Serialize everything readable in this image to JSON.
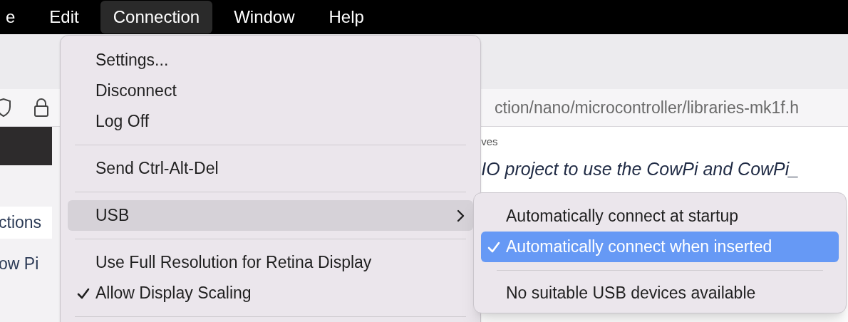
{
  "menu_bar": [
    {
      "label": "e",
      "selected": false
    },
    {
      "label": "Edit",
      "selected": false
    },
    {
      "label": "Connection",
      "selected": true
    },
    {
      "label": "Window",
      "selected": false
    },
    {
      "label": "Help",
      "selected": false
    }
  ],
  "browser": {
    "url": "ction/nano/microcontroller/libraries-mk1f.h",
    "sidebar_items": [
      "ctions",
      "ow Pi"
    ],
    "breadcrumb": "ves",
    "heading": "IO project to use the CowPi and CowPi_"
  },
  "menu": [
    {
      "kind": "item",
      "label": "Settings...",
      "checked": false,
      "selected": false
    },
    {
      "kind": "item",
      "label": "Disconnect",
      "checked": false,
      "selected": false
    },
    {
      "kind": "item",
      "label": "Log Off",
      "checked": false,
      "selected": false
    },
    {
      "kind": "separator"
    },
    {
      "kind": "item",
      "label": "Send Ctrl-Alt-Del",
      "checked": false,
      "selected": false
    },
    {
      "kind": "separator"
    },
    {
      "kind": "submenu",
      "label": "USB",
      "checked": false,
      "selected": true
    },
    {
      "kind": "separator"
    },
    {
      "kind": "item",
      "label": "Use Full Resolution for Retina Display",
      "checked": false,
      "selected": false
    },
    {
      "kind": "item",
      "label": "Allow Display Scaling",
      "checked": true,
      "selected": false
    },
    {
      "kind": "separator"
    }
  ],
  "submenu": [
    {
      "kind": "item",
      "label": "Automatically connect at startup",
      "checked": false,
      "selected": false
    },
    {
      "kind": "item",
      "label": "Automatically connect when inserted",
      "checked": true,
      "selected": true
    },
    {
      "kind": "separator"
    },
    {
      "kind": "item",
      "label": "No suitable USB devices available",
      "checked": false,
      "selected": false
    }
  ]
}
